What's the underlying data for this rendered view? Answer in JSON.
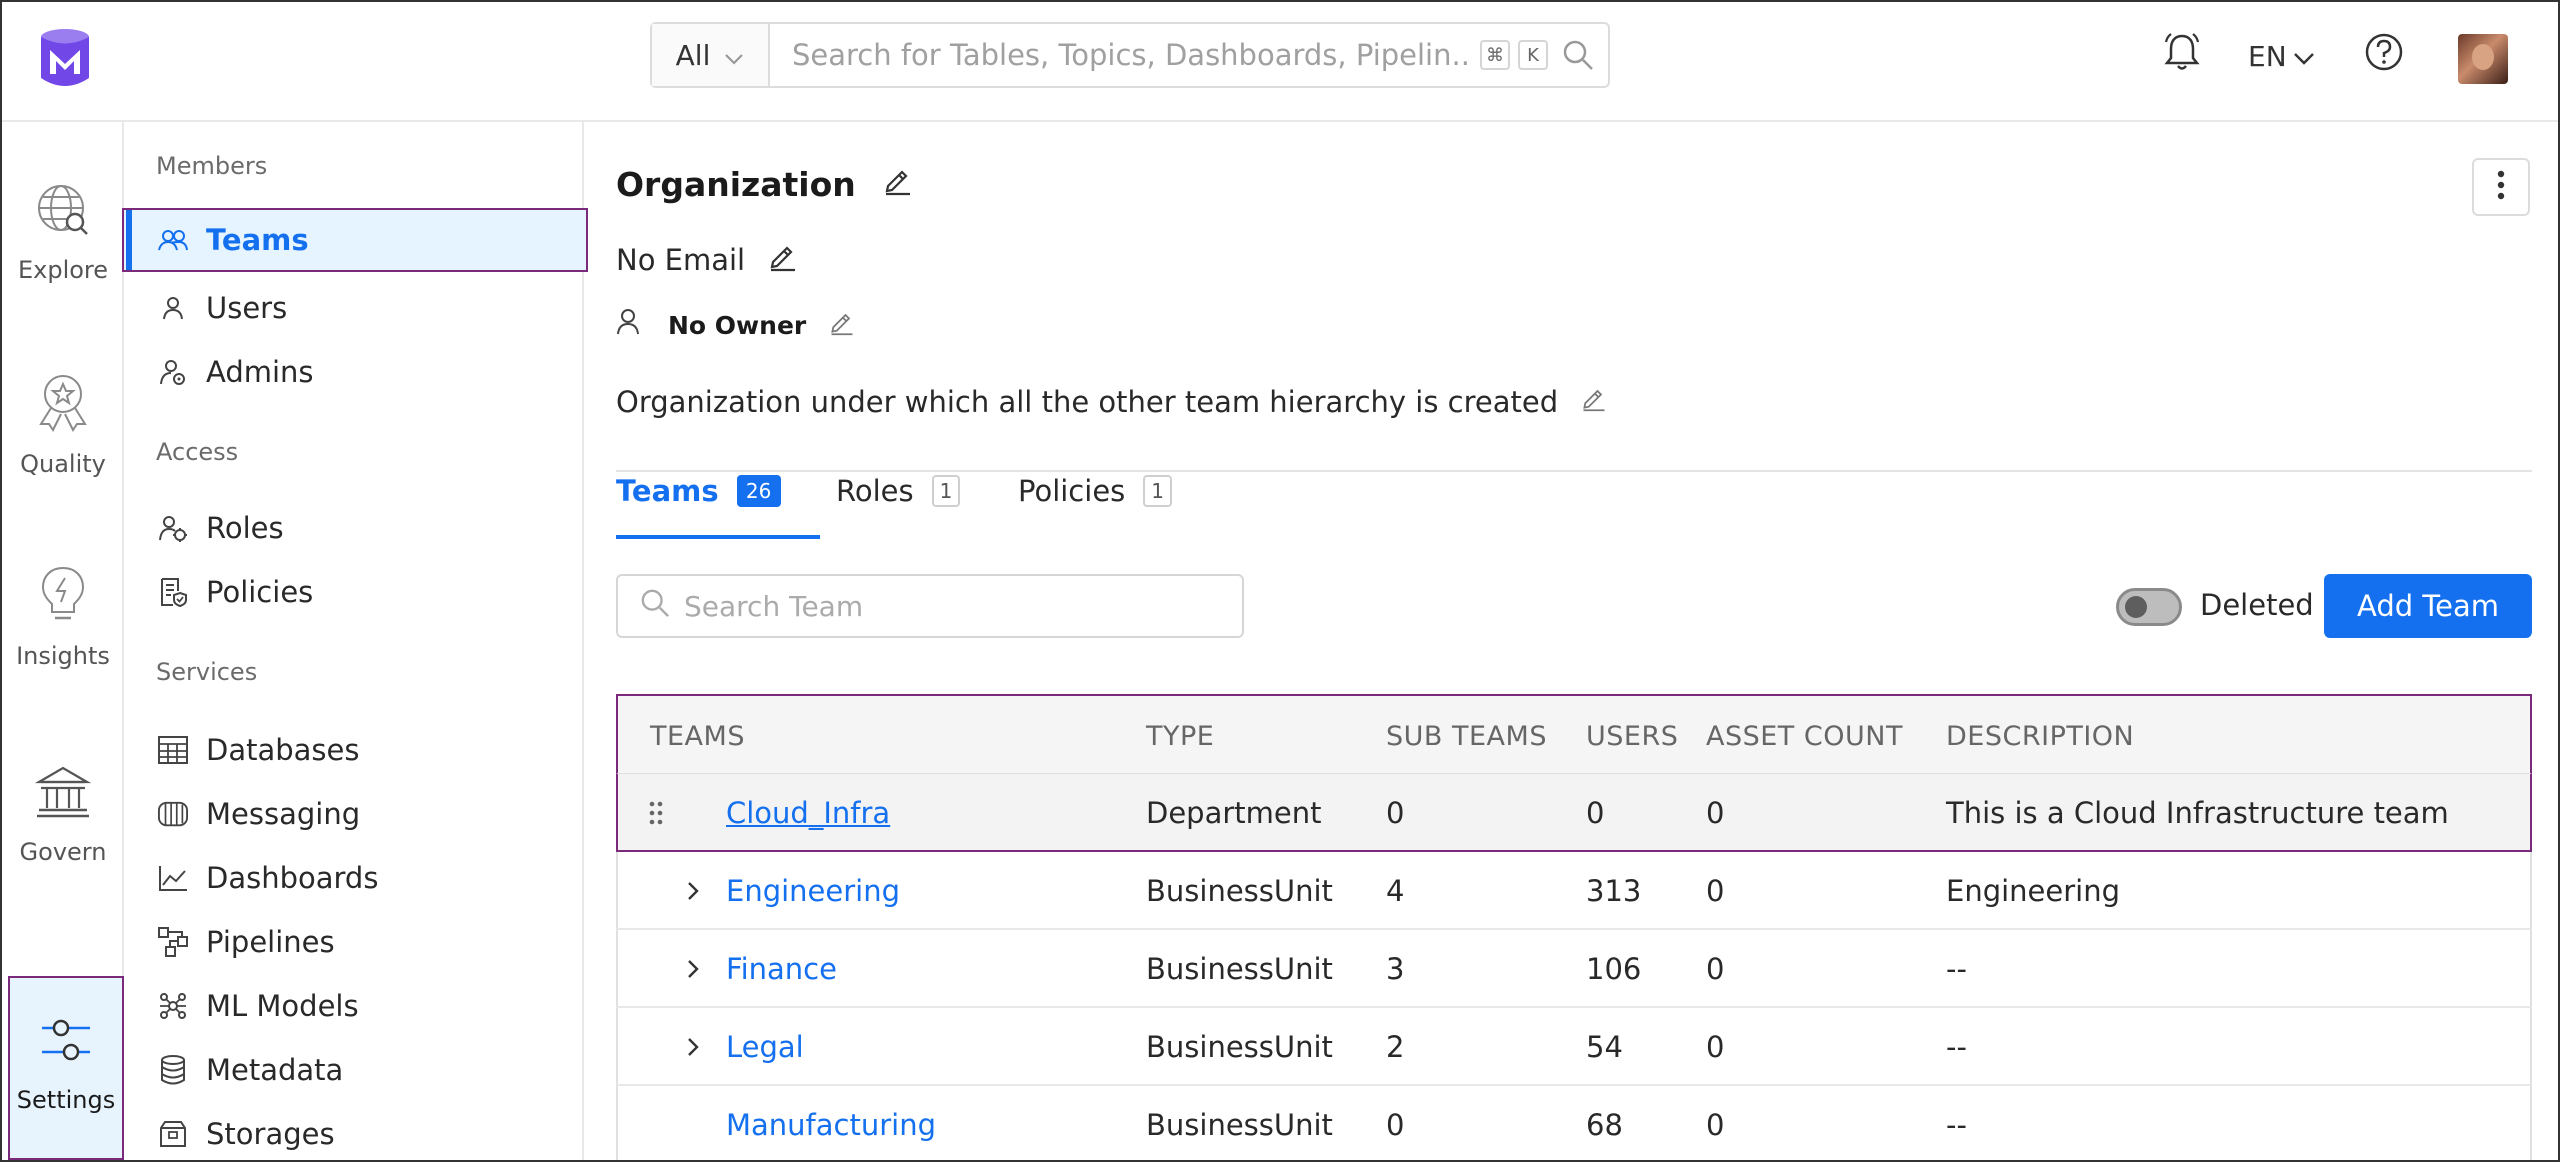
{
  "header": {
    "search_scope": "All",
    "search_placeholder": "Search for Tables, Topics, Dashboards, Pipelin...",
    "kbd_cmd": "⌘",
    "kbd_k": "K",
    "language": "EN"
  },
  "rail": [
    {
      "label": "Explore",
      "icon": "globe-search-icon"
    },
    {
      "label": "Quality",
      "icon": "badge-icon"
    },
    {
      "label": "Insights",
      "icon": "lightbulb-icon"
    },
    {
      "label": "Govern",
      "icon": "bank-icon"
    },
    {
      "label": "Settings",
      "icon": "sliders-icon"
    }
  ],
  "sidebar": {
    "sections": [
      {
        "heading": "Members",
        "items": [
          "Teams",
          "Users",
          "Admins"
        ]
      },
      {
        "heading": "Access",
        "items": [
          "Roles",
          "Policies"
        ]
      },
      {
        "heading": "Services",
        "items": [
          "Databases",
          "Messaging",
          "Dashboards",
          "Pipelines",
          "ML Models",
          "Metadata",
          "Storages"
        ]
      }
    ],
    "active": "Teams"
  },
  "main": {
    "title": "Organization",
    "email": "No Email",
    "owner": "No Owner",
    "description": "Organization under which all the other team hierarchy is created",
    "tabs": [
      {
        "label": "Teams",
        "count": "26"
      },
      {
        "label": "Roles",
        "count": "1"
      },
      {
        "label": "Policies",
        "count": "1"
      }
    ],
    "search_placeholder": "Search Team",
    "deleted_label": "Deleted",
    "add_button": "Add Team",
    "table": {
      "headers": [
        "TEAMS",
        "TYPE",
        "SUB TEAMS",
        "USERS",
        "ASSET COUNT",
        "DESCRIPTION"
      ],
      "rows": [
        {
          "name": "Cloud_Infra",
          "type": "Department",
          "sub_teams": "0",
          "users": "0",
          "asset_count": "0",
          "description": "This is a Cloud Infrastructure team"
        },
        {
          "name": "Engineering",
          "type": "BusinessUnit",
          "sub_teams": "4",
          "users": "313",
          "asset_count": "0",
          "description": "Engineering"
        },
        {
          "name": "Finance",
          "type": "BusinessUnit",
          "sub_teams": "3",
          "users": "106",
          "asset_count": "0",
          "description": "--"
        },
        {
          "name": "Legal",
          "type": "BusinessUnit",
          "sub_teams": "2",
          "users": "54",
          "asset_count": "0",
          "description": "--"
        },
        {
          "name": "Manufacturing",
          "type": "BusinessUnit",
          "sub_teams": "0",
          "users": "68",
          "asset_count": "0",
          "description": "--"
        }
      ]
    }
  },
  "colors": {
    "accent": "#1470ef",
    "highlight_border": "#7b2a7b",
    "brand": "#7147e8"
  }
}
